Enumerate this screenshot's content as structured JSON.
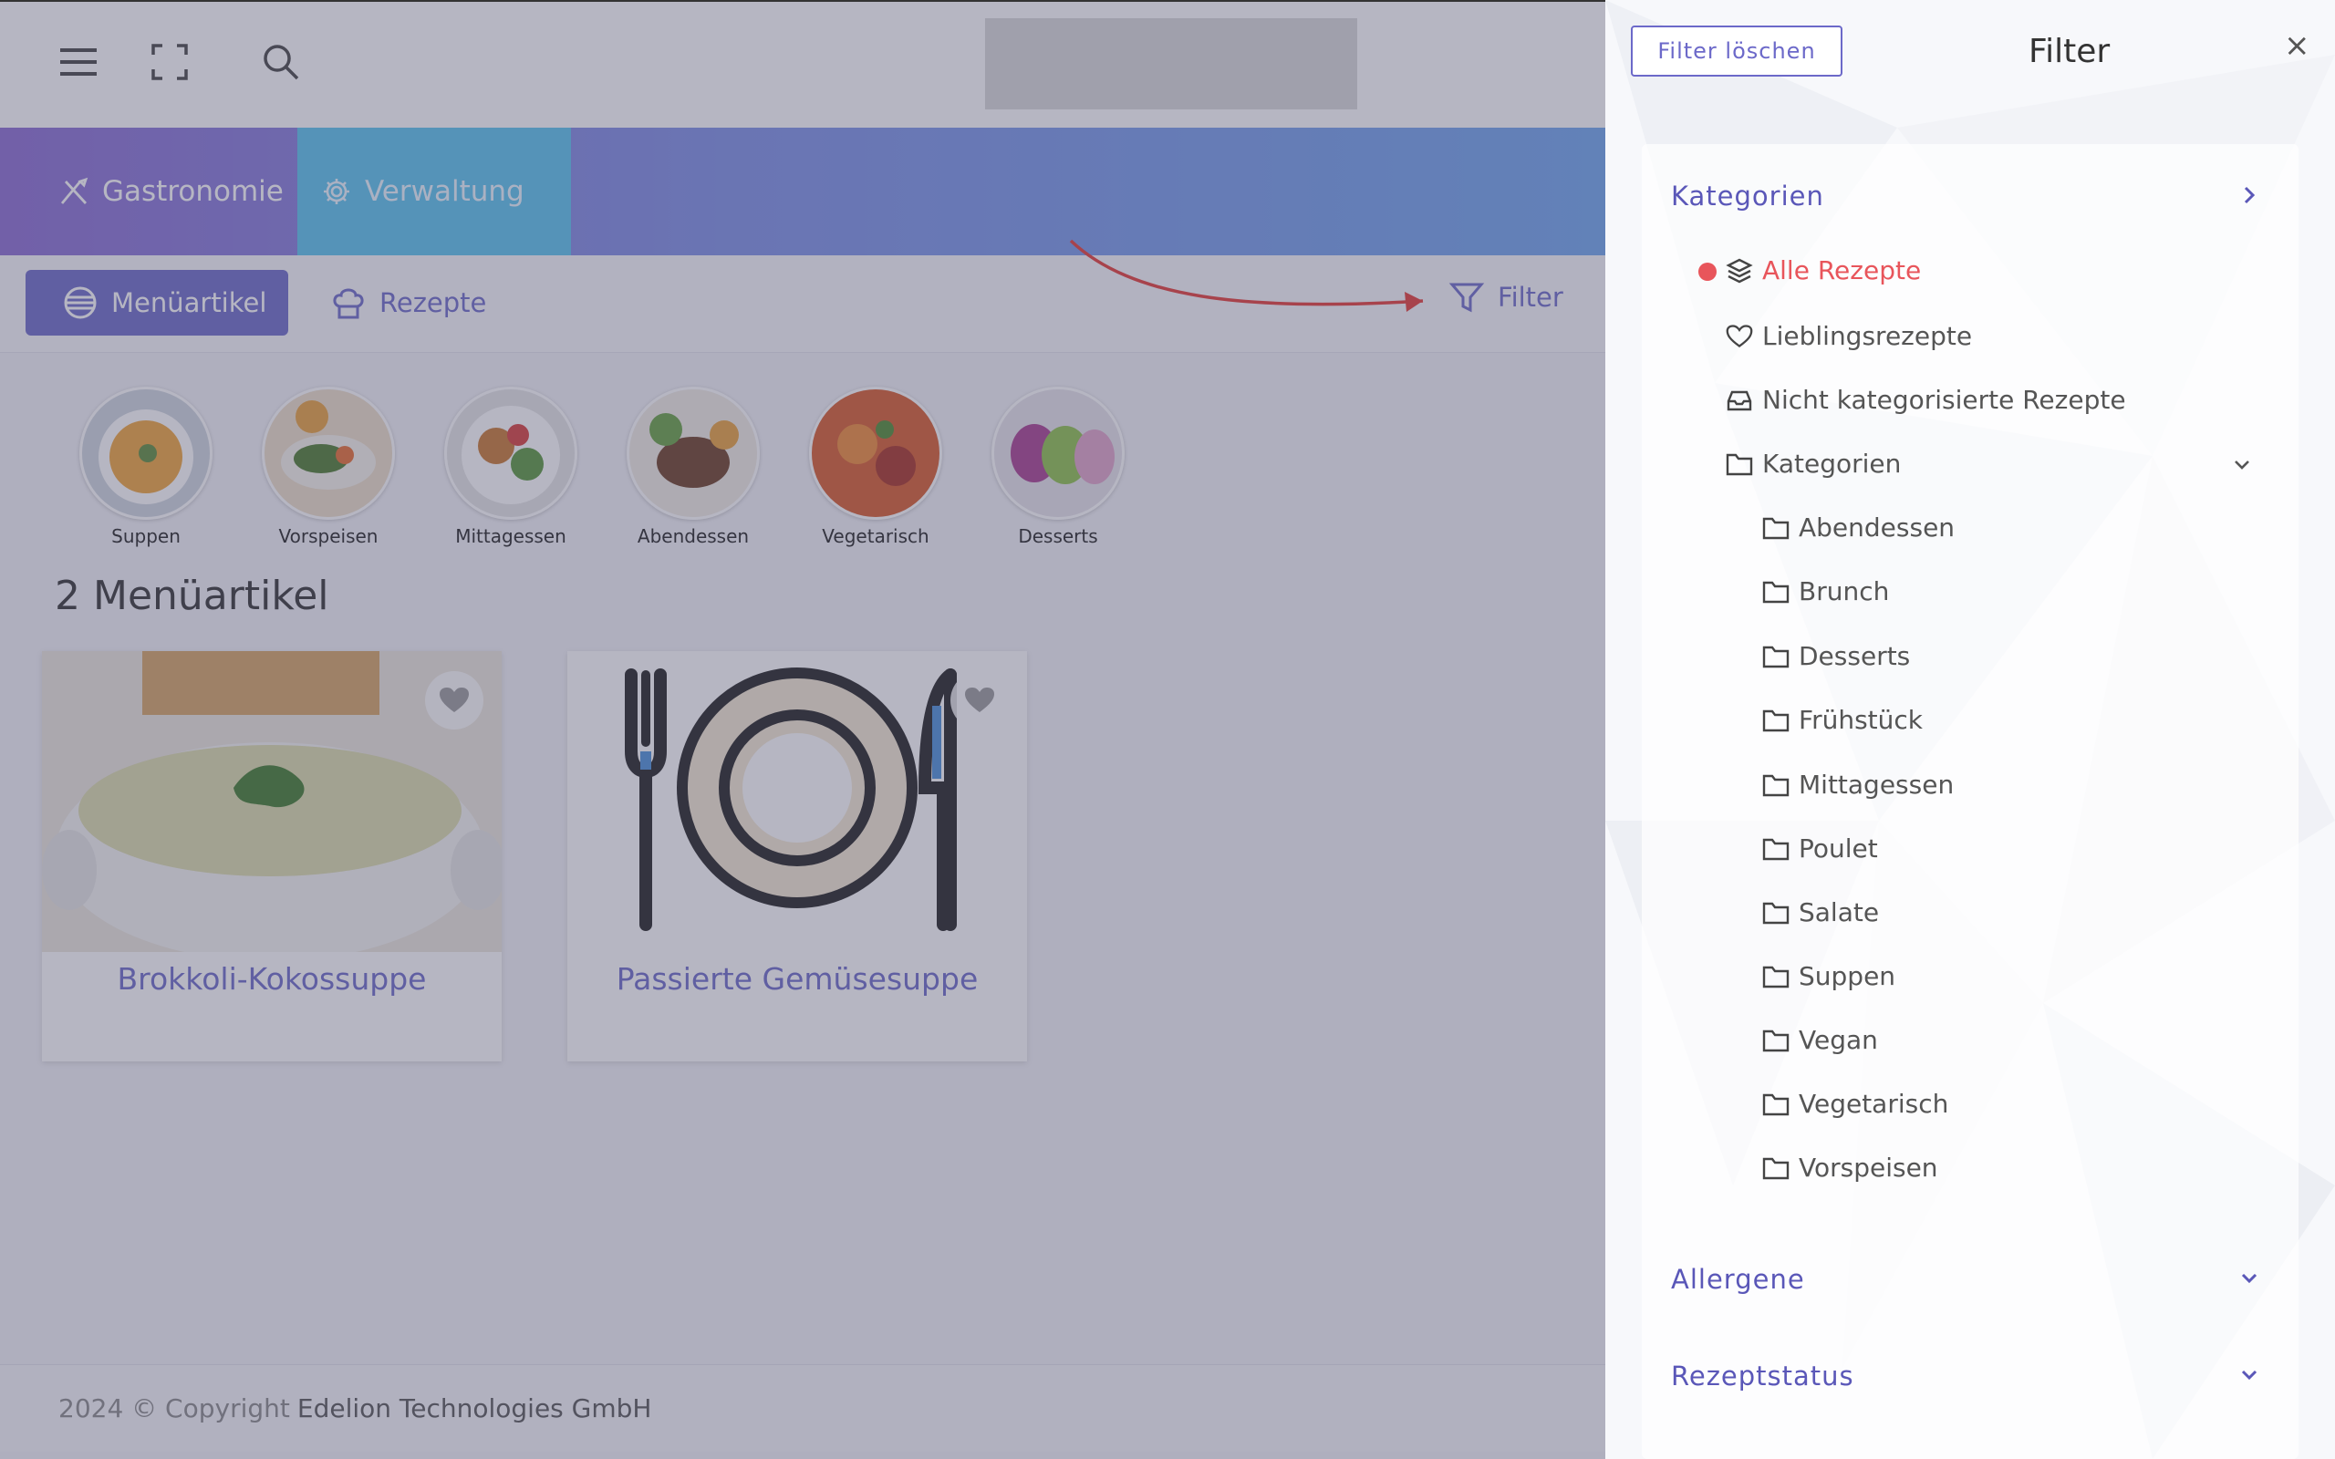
{
  "nav": {
    "brand_tabs": [
      {
        "label": "Gastronomie",
        "icon": "cutlery-icon"
      },
      {
        "label": "Verwaltung",
        "icon": "gear-icon"
      }
    ],
    "sub_tabs": [
      {
        "label": "Menüartikel",
        "icon": "plate-icon",
        "active": true
      },
      {
        "label": "Rezepte",
        "icon": "chef-hat-icon",
        "active": false
      }
    ],
    "filter_label": "Filter"
  },
  "categories": [
    {
      "label": "Suppen"
    },
    {
      "label": "Vorspeisen"
    },
    {
      "label": "Mittagessen"
    },
    {
      "label": "Abendessen"
    },
    {
      "label": "Vegetarisch"
    },
    {
      "label": "Desserts"
    }
  ],
  "content": {
    "count_title": "2 Menüartikel",
    "cards": [
      {
        "title": "Brokkoli-Kokossuppe"
      },
      {
        "title": "Passierte Gemüsesuppe"
      }
    ]
  },
  "footer": {
    "prefix": "2024 © Copyright",
    "company": "Edelion Technologies GmbH"
  },
  "panel": {
    "clear_label": "Filter löschen",
    "title": "Filter",
    "close": "×",
    "sections": {
      "kategorien": "Kategorien",
      "allergene": "Allergene",
      "rezeptstatus": "Rezeptstatus"
    },
    "top_items": [
      {
        "label": "Alle Rezepte",
        "icon": "layers-icon"
      },
      {
        "label": "Lieblingsrezepte",
        "icon": "heart-icon"
      },
      {
        "label": "Nicht kategorisierte Rezepte",
        "icon": "inbox-icon"
      },
      {
        "label": "Kategorien",
        "icon": "folder-icon"
      }
    ],
    "sub_items": [
      {
        "label": "Abendessen"
      },
      {
        "label": "Brunch"
      },
      {
        "label": "Desserts"
      },
      {
        "label": "Frühstück"
      },
      {
        "label": "Mittagessen"
      },
      {
        "label": "Poulet"
      },
      {
        "label": "Salate"
      },
      {
        "label": "Suppen"
      },
      {
        "label": "Vegan"
      },
      {
        "label": "Vegetarisch"
      },
      {
        "label": "Vorspeisen"
      }
    ]
  },
  "colors": {
    "accent": "#6c69c9",
    "active": "#e8555b",
    "overlay": "#505070"
  }
}
